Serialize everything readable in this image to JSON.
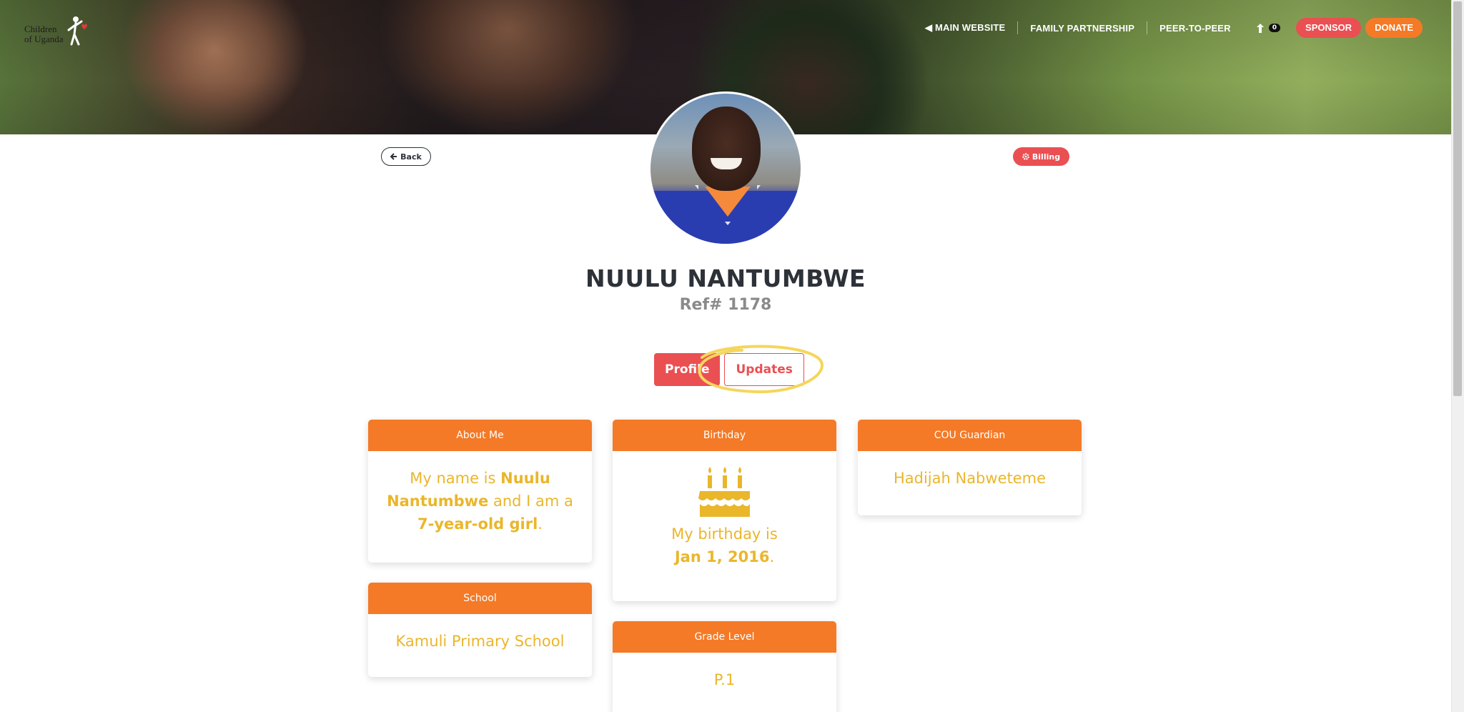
{
  "logo": {
    "text_line1": "Children",
    "text_line2": "of Uganda"
  },
  "nav": {
    "main_website": "◀ MAIN WEBSITE",
    "family_partnership": "FAMILY PARTNERSHIP",
    "peer_to_peer": "PEER-TO-PEER",
    "cart_count": "0",
    "sponsor": "SPONSOR",
    "donate": "DONATE"
  },
  "actions": {
    "back": "Back",
    "billing": "Billing"
  },
  "child": {
    "name": "NUULU NANTUMBWE",
    "ref": "Ref# 1178"
  },
  "tabs": {
    "profile": "Profile",
    "updates": "Updates"
  },
  "cards": {
    "about": {
      "title": "About Me",
      "pre": "My name is ",
      "name": "Nuulu Nantumbwe",
      "mid": " and I am a ",
      "age": "7-year-old girl",
      "post": "."
    },
    "birthday": {
      "title": "Birthday",
      "pre": "My birthday is",
      "date": "Jan 1, 2016",
      "post": "."
    },
    "guardian": {
      "title": "COU Guardian",
      "value": "Hadijah Nabweteme"
    },
    "school": {
      "title": "School",
      "value": "Kamuli Primary School"
    },
    "grade": {
      "title": "Grade Level",
      "value": "P.1"
    }
  },
  "colors": {
    "orange": "#f47a27",
    "red": "#ea4f52",
    "gold": "#eab62a",
    "dark": "#2d3138"
  },
  "icons": [
    "child-logo-icon",
    "arrow-left-icon",
    "gear-icon",
    "cart-icon",
    "cake-icon"
  ]
}
